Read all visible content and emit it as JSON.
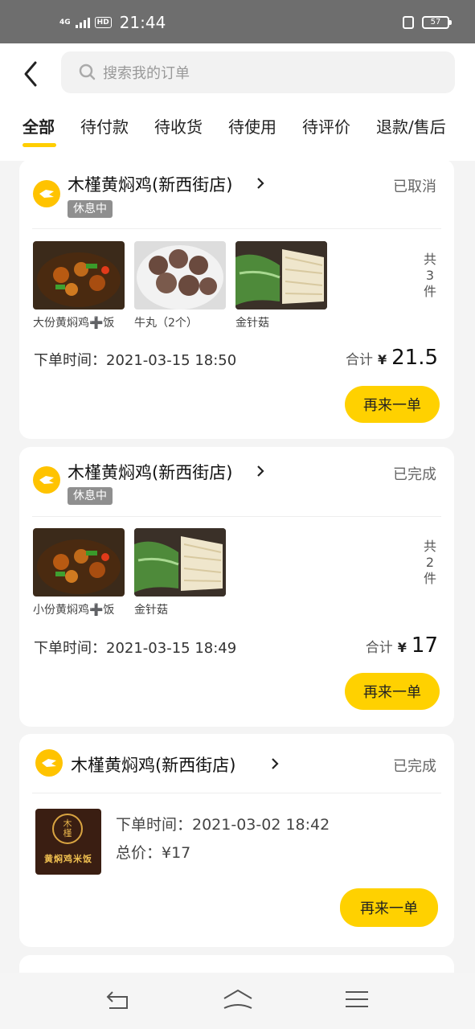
{
  "status_bar": {
    "network": "4G",
    "hd": "HD",
    "time": "21:44",
    "battery": "57"
  },
  "search": {
    "placeholder": "搜索我的订单"
  },
  "tabs": [
    "全部",
    "待付款",
    "待收货",
    "待使用",
    "待评价",
    "退款/售后"
  ],
  "colors": {
    "accent": "#ffd100",
    "tab_indicator": "#ffce00",
    "rest_badge": "#8f8f8f"
  },
  "orders": [
    {
      "shop": "木槿黄焖鸡(新西街店)",
      "status": "已取消",
      "rest_badge": "休息中",
      "items": [
        {
          "name": "大份黄焖鸡➕饭",
          "image": "braised-chicken-pot"
        },
        {
          "name": "牛丸（2个）",
          "image": "beef-balls"
        },
        {
          "name": "金针菇",
          "image": "enoki-and-greens"
        }
      ],
      "count": [
        "共",
        "3",
        "件"
      ],
      "order_time": "下单时间：2021-03-15 18:50",
      "total_label": "合计",
      "currency": "¥",
      "total": "21.5",
      "button": "再来一单"
    },
    {
      "shop": "木槿黄焖鸡(新西街店)",
      "status": "已完成",
      "rest_badge": "休息中",
      "items": [
        {
          "name": "小份黄焖鸡➕饭",
          "image": "braised-chicken-pot"
        },
        {
          "name": "金针菇",
          "image": "enoki-and-greens"
        }
      ],
      "count": [
        "共",
        "2",
        "件"
      ],
      "order_time": "下单时间：2021-03-15 18:49",
      "total_label": "合计",
      "currency": "¥",
      "total": "17",
      "button": "再来一单"
    },
    {
      "shop": "木槿黄焖鸡(新西街店)",
      "status": "已完成",
      "logo_text": [
        "木",
        "槿",
        "黄焖鸡米饭"
      ],
      "order_time": "下单时间：2021-03-02 18:42",
      "total_text": "总价：¥17",
      "button": "再来一单"
    }
  ],
  "nav_bar": {
    "icons": [
      "back-nav-icon",
      "home-nav-icon",
      "menu-nav-icon"
    ]
  }
}
